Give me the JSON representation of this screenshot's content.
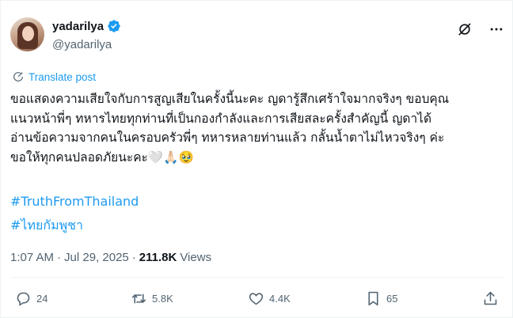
{
  "author": {
    "display_name": "yadarilya",
    "handle": "@yadarilya",
    "verified": true
  },
  "header": {
    "grok_icon": "grok-icon",
    "more_icon": "more-icon"
  },
  "translate": {
    "label": "Translate post"
  },
  "post": {
    "lines": [
      "ขอแสดงความเสียใจกับการสูญเสียในครั้งนี้นะคะ ญดารู้สึกเศร้าใจมากจริงๆ ขอบคุณ",
      "แนวหน้าพี่ๆ ทหารไทยทุกท่านที่เป็นกองกำลังและการเสียสละครั้งสำคัญนี้ ญดาได้",
      "อ่านข้อความจากคนในครอบครัวพี่ๆ ทหารหลายท่านแล้ว กลั้นน้ำตาไม่ไหวจริงๆ ค่ะ",
      "ขอให้ทุกคนปลอดภัยนะคะ🤍🙏🏻🥹"
    ],
    "hashtags": [
      "#TruthFromThailand",
      "#ไทยกัมพูชา"
    ]
  },
  "meta": {
    "time": "1:07 AM",
    "dot": "·",
    "date": "Jul 29, 2025",
    "views_count": "211.8K",
    "views_label": "Views"
  },
  "actions": {
    "replies": "24",
    "reposts": "5.8K",
    "likes": "4.4K",
    "bookmarks": "65"
  },
  "colors": {
    "accent": "#1d9bf0",
    "text": "#0f1419",
    "muted": "#536471"
  }
}
